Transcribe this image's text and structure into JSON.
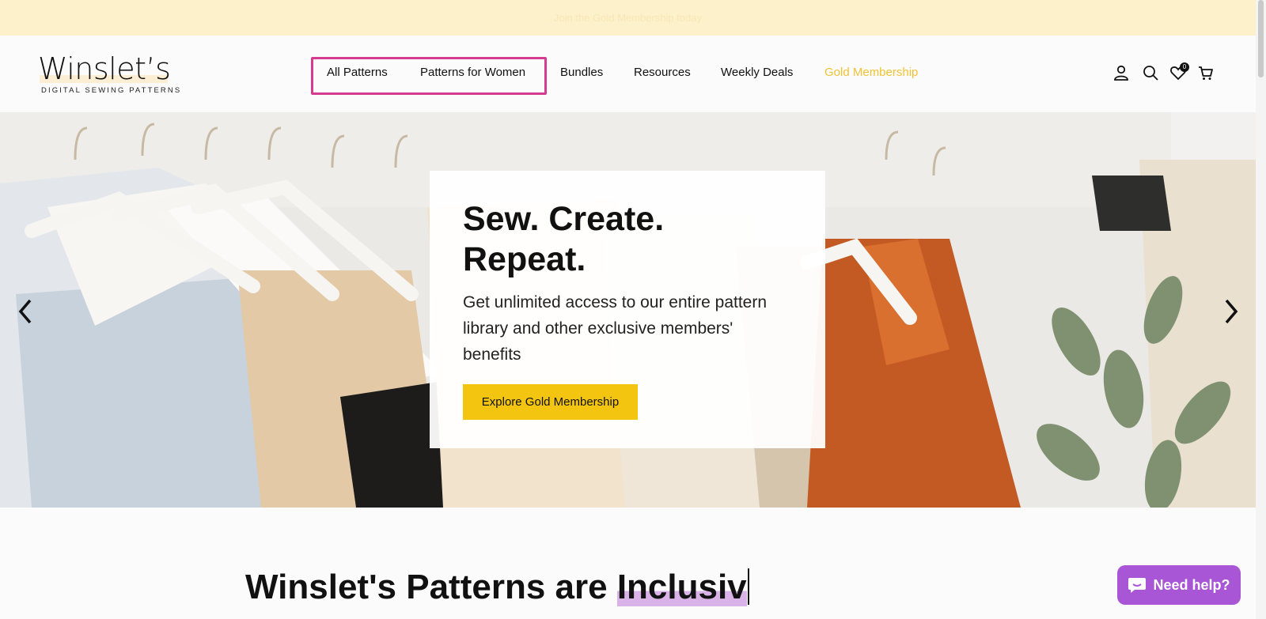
{
  "announcement": {
    "text": "Join the Gold Membership today"
  },
  "logo": {
    "word": "Winslet’s",
    "tagline": "DIGITAL SEWING PATTERNS"
  },
  "nav": {
    "items": [
      {
        "label": "All Patterns"
      },
      {
        "label": "Patterns for Women"
      },
      {
        "label": "Bundles"
      },
      {
        "label": "Resources"
      },
      {
        "label": "Weekly Deals"
      },
      {
        "label": "Gold Membership"
      }
    ],
    "highlight_color": "#d63b92",
    "gold_color": "#f0c332"
  },
  "header_icons": {
    "account": "account-icon",
    "search": "search-icon",
    "wishlist": "heart-icon",
    "wishlist_count": "0",
    "cart": "cart-icon"
  },
  "hero": {
    "title": "Sew. Create. Repeat.",
    "text": "Get unlimited access to our entire pattern library and other exclusive members' benefits",
    "button_label": "Explore Gold Membership",
    "button_color": "#f3c510",
    "prev_icon": "chevron-left-icon",
    "next_icon": "chevron-right-icon"
  },
  "section": {
    "title_prefix": "Winslet's Patterns are ",
    "title_selected": "Inclusiv"
  },
  "help": {
    "label": "Need help?",
    "color": "#a855d6"
  }
}
